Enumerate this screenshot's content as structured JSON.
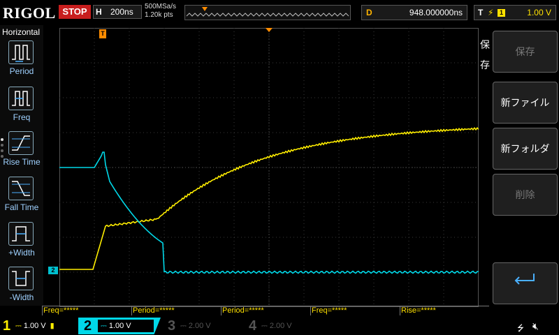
{
  "header": {
    "logo": "RIGOL",
    "run_state": "STOP",
    "hbase_label": "H",
    "hbase_value": "200ns",
    "sample_rate": "500MSa/s",
    "points": "1.20k pts",
    "delay_label": "D",
    "delay_value": "948.000000ns",
    "trigger_label": "T",
    "trigger_source": "1",
    "trigger_level": "1.00 V"
  },
  "sidebar": {
    "title": "Horizontal",
    "items": [
      {
        "label": "Period"
      },
      {
        "label": "Freq"
      },
      {
        "label": "Rise Time"
      },
      {
        "label": "Fall Time"
      },
      {
        "label": "+Width"
      },
      {
        "label": "-Width"
      }
    ]
  },
  "plot": {
    "trigger_marker": "T",
    "ch2_marker": "2",
    "colors": {
      "ch1": "#ffee00",
      "ch2": "#00d8e8",
      "grid": "#3a3a3a",
      "trigger": "#ff8c00"
    }
  },
  "right_menu": {
    "title": "保存",
    "buttons": [
      {
        "label": "保存",
        "enabled": false
      },
      {
        "label": "新ファイル",
        "enabled": true
      },
      {
        "label": "新フォルダ",
        "enabled": true
      },
      {
        "label": "削除",
        "enabled": false
      },
      {
        "label": "return-icon",
        "enabled": true
      }
    ]
  },
  "measurements": [
    {
      "label": "Freq=*****"
    },
    {
      "label": "Period=*****"
    },
    {
      "label": "Period=*****"
    },
    {
      "label": "Freq=*****"
    },
    {
      "label": "Rise=*****"
    }
  ],
  "channels": [
    {
      "num": "1",
      "scale": "1.00 V",
      "color": "#ffee00",
      "active": true
    },
    {
      "num": "2",
      "scale": "1.00 V",
      "color": "#00d8e8",
      "active": true
    },
    {
      "num": "3",
      "scale": "2.00 V",
      "color": "#555555",
      "active": false
    },
    {
      "num": "4",
      "scale": "2.00 V",
      "color": "#555555",
      "active": false
    }
  ]
}
